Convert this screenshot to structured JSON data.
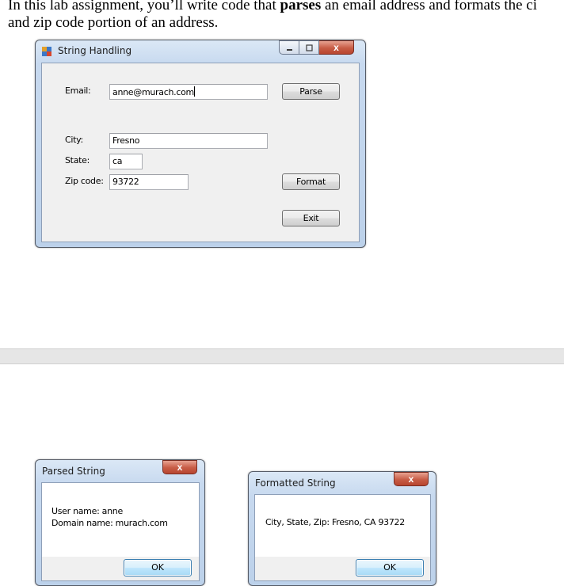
{
  "doc": {
    "line1_prefix": "In this lab assignment, you’ll write code that ",
    "line1_bold": "parses",
    "line1_suffix": " an email address and formats the ci",
    "line2": "and zip code portion of an address."
  },
  "main_window": {
    "title": "String Handling",
    "email_label": "Email:",
    "email_value": "anne@murach.com",
    "city_label": "City:",
    "city_value": "Fresno",
    "state_label": "State:",
    "state_value": "ca",
    "zip_label": "Zip code:",
    "zip_value": "93722",
    "parse_button": "Parse",
    "format_button": "Format",
    "exit_button": "Exit",
    "close_glyph": "x"
  },
  "parsed_dialog": {
    "title": "Parsed String",
    "line1": "User name: anne",
    "line2": "Domain name: murach.com",
    "ok_button": "OK",
    "close_glyph": "x"
  },
  "formatted_dialog": {
    "title": "Formatted String",
    "line1": "City, State, Zip: Fresno, CA 93722",
    "ok_button": "OK",
    "close_glyph": "x"
  }
}
